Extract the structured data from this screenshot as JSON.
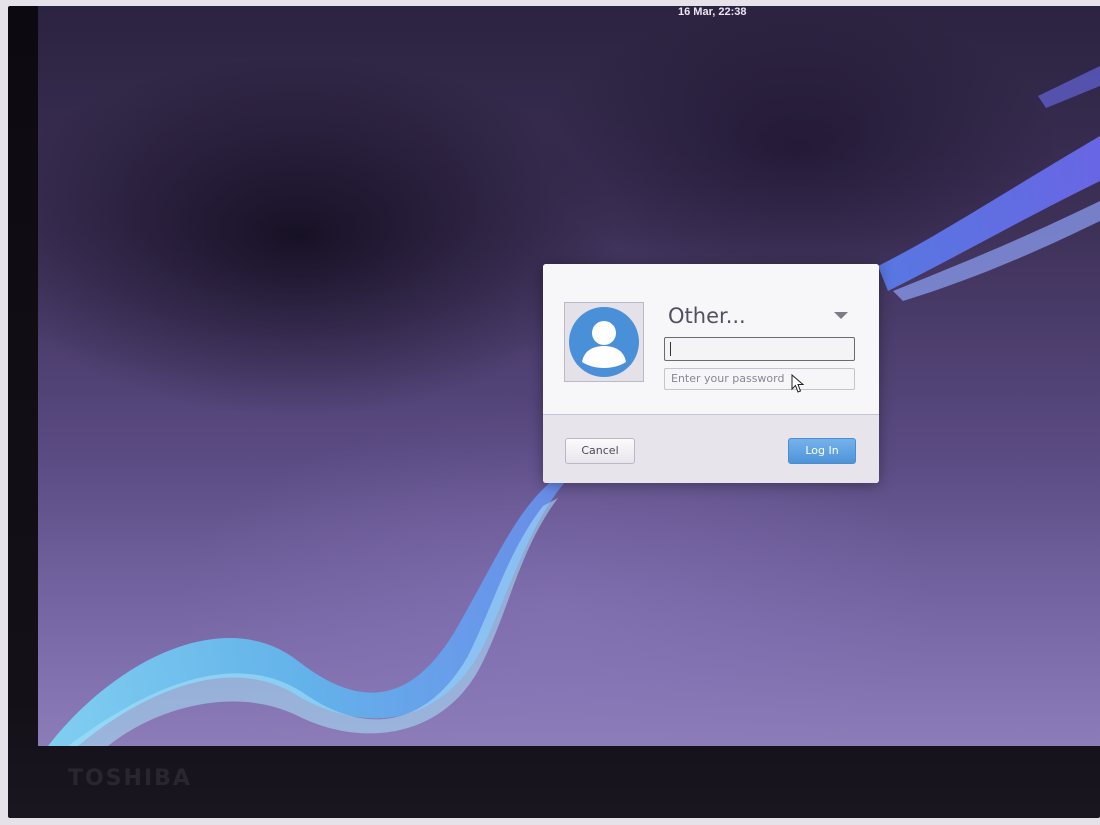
{
  "top_panel": {
    "left_text": "",
    "clock": "16 Mar, 22:38"
  },
  "login_dialog": {
    "user_name": "Other...",
    "username_value": "",
    "password_placeholder": "Enter your password",
    "cancel_label": "Cancel",
    "login_label": "Log In"
  },
  "monitor": {
    "brand": "TOSHIBA"
  },
  "colors": {
    "login_button": "#5a9ee0",
    "avatar": "#4a90d9",
    "wallpaper": "#5a4a82"
  },
  "icons": {
    "avatar": "user-avatar-icon",
    "dropdown": "chevron-down-icon",
    "pointer": "mouse-pointer-icon"
  }
}
